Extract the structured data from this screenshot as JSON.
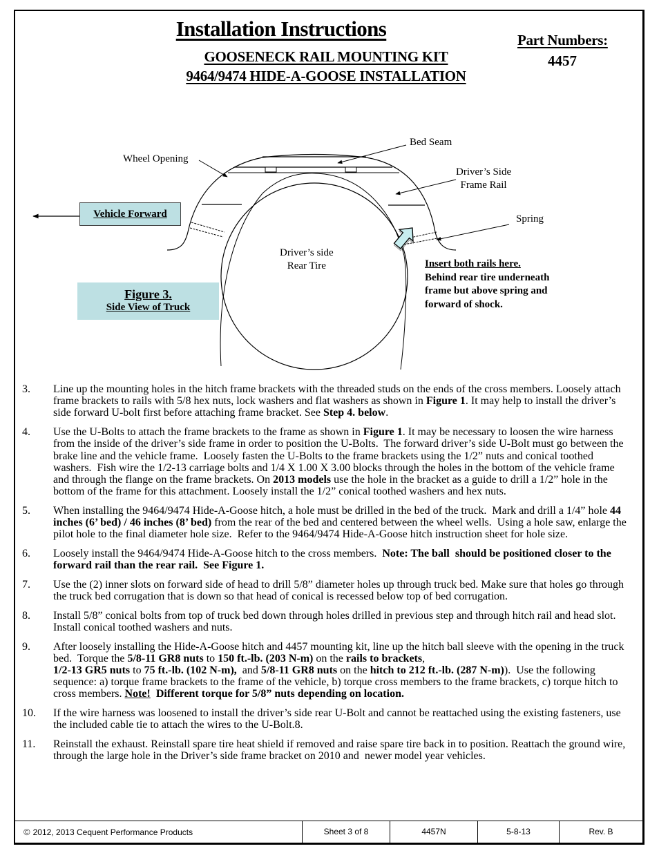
{
  "header": {
    "title": "Installation Instructions",
    "subtitle_line1": "GOOSENECK RAIL MOUNTING KIT",
    "subtitle_line2": "9464/9474 HIDE-A-GOOSE INSTALLATION",
    "part_numbers_label": "Part Numbers:",
    "part_number": "4457"
  },
  "figure": {
    "labels": {
      "bed_seam": "Bed Seam",
      "wheel_opening": "Wheel Opening",
      "frame_rail_line1": "Driver’s Side",
      "frame_rail_line2": "Frame Rail",
      "spring": "Spring",
      "tire_line1": "Driver’s side",
      "tire_line2": "Rear Tire",
      "vehicle_forward": "Vehicle Forward"
    },
    "caption_title": "Figure 3.",
    "caption_subtitle": "Side View of Truck",
    "insert_note": {
      "heading": "Insert both rails here.",
      "line1": "Behind rear tire underneath",
      "line2": "frame but above spring and",
      "line3": "forward of shock."
    },
    "colors": {
      "callout_fill": "#bde0e3",
      "arrow_fill": "#c8eef0"
    }
  },
  "steps": [
    {
      "number": "3.",
      "segments": [
        {
          "text": "Line up the mounting holes in the hitch frame brackets with the threaded studs on the ends of the cross members. Loosely attach frame brackets to rails with 5/8 hex nuts, lock washers and flat washers as shown in "
        },
        {
          "text": "Figure 1",
          "bold": true
        },
        {
          "text": ". It may help to install the driver’s side forward U-bolt first before attaching frame bracket. See "
        },
        {
          "text": "Step 4. below",
          "bold": true
        },
        {
          "text": "."
        }
      ]
    },
    {
      "number": "4.",
      "segments": [
        {
          "text": "Use the U-Bolts to attach the frame brackets to the frame as shown in "
        },
        {
          "text": "Figure 1",
          "bold": true
        },
        {
          "text": ". It may be necessary to loosen the wire harness from the inside of the driver’s side frame in order to position the U-Bolts.  The forward driver’s side U-Bolt must go between the brake line and the vehicle frame.  Loosely fasten the U-Bolts to the frame brackets using the 1/2” nuts and conical toothed washers.  Fish wire the 1/2-13 carriage bolts and 1/4 X 1.00 X 3.00 blocks through the holes in the bottom of the vehicle frame and through the flange on the frame brackets. On "
        },
        {
          "text": "2013 models",
          "bold": true
        },
        {
          "text": " use the hole in the bracket as a guide to drill a 1/2” hole in the bottom of the frame for this attachment. Loosely install the 1/2” conical toothed washers and hex nuts."
        }
      ]
    },
    {
      "number": "5.",
      "segments": [
        {
          "text": "When installing the 9464/9474 Hide-A-Goose hitch, a hole must be drilled in the bed of the truck.  Mark and drill a 1/4” hole "
        },
        {
          "text": "44 inches (6’ bed) / 46 inches (8’ bed)",
          "bold": true
        },
        {
          "text": " from the rear of the bed and centered between the wheel wells.  Using a hole saw, enlarge the pilot hole to the final diameter hole size.  Refer to the 9464/9474 Hide-A-Goose hitch instruction sheet for hole size."
        }
      ]
    },
    {
      "number": "6.",
      "segments": [
        {
          "text": "Loosely install the 9464/9474 Hide-A-Goose hitch to the cross members.  "
        },
        {
          "text": "Note: The ball  should be positioned closer to the forward rail than the rear rail.  See Figure 1.",
          "bold": true
        }
      ]
    },
    {
      "number": "7.",
      "segments": [
        {
          "text": "Use the (2) inner slots on forward side of head to drill 5/8” diameter holes up through truck bed. Make sure that holes go through the truck bed corrugation that is down so that head of conical is recessed below top of bed corrugation."
        }
      ]
    },
    {
      "number": "8.",
      "segments": [
        {
          "text": "Install 5/8” conical bolts from top of truck bed down through holes drilled in previous step and through hitch rail and head slot.  Install conical toothed washers and nuts."
        }
      ]
    },
    {
      "number": "9.",
      "segments": [
        {
          "text": "After loosely installing the Hide-A-Goose hitch and 4457 mounting kit, line up the hitch ball sleeve with the opening in the truck bed.  Torque the "
        },
        {
          "text": "5/8-11 GR8 nuts",
          "bold": true
        },
        {
          "text": " to "
        },
        {
          "text": "150 ft.-lb. (203 N-m)",
          "bold": true
        },
        {
          "text": " on the "
        },
        {
          "text": "rails to brackets",
          "bold": true
        },
        {
          "text": ",",
          "break_after": true
        },
        {
          "text": "1/2-13 GR5 nuts",
          "bold": true
        },
        {
          "text": " to "
        },
        {
          "text": "75 ft.-lb. (102 N-m),",
          "bold": true
        },
        {
          "text": "  and "
        },
        {
          "text": "5/8-11 GR8 nuts",
          "bold": true
        },
        {
          "text": " on the "
        },
        {
          "text": "hitch to 212 ft.-lb. (287 N-m)",
          "bold": true
        },
        {
          "text": ").  Use the following sequence: a) torque frame brackets to the frame of the vehicle, b) torque cross members to the frame brackets, c) torque hitch to cross members. "
        },
        {
          "text": "Note!",
          "bold": true,
          "underline": true
        },
        {
          "text": "  Different torque for 5/8” nuts depending on location.",
          "bold": true
        }
      ]
    },
    {
      "number": "10.",
      "segments": [
        {
          "text": "If the wire harness was loosened to install the driver’s side rear U-Bolt and cannot be reattached using the existing fasteners, use the included cable tie to attach the wires to the U-Bolt.8."
        }
      ]
    },
    {
      "number": "11.",
      "segments": [
        {
          "text": "Reinstall the exhaust. Reinstall spare tire heat shield if removed and raise spare tire back in to position. Reattach the ground wire, through the large hole in the Driver’s side frame bracket on 2010 and  newer model year vehicles."
        }
      ]
    }
  ],
  "footer": {
    "copyright_symbol": "©",
    "copyright": "2012, 2013 Cequent Performance Products",
    "sheet": "Sheet 3 of 8",
    "doc_number": "4457N",
    "date": "5-8-13",
    "revision": "Rev. B"
  }
}
